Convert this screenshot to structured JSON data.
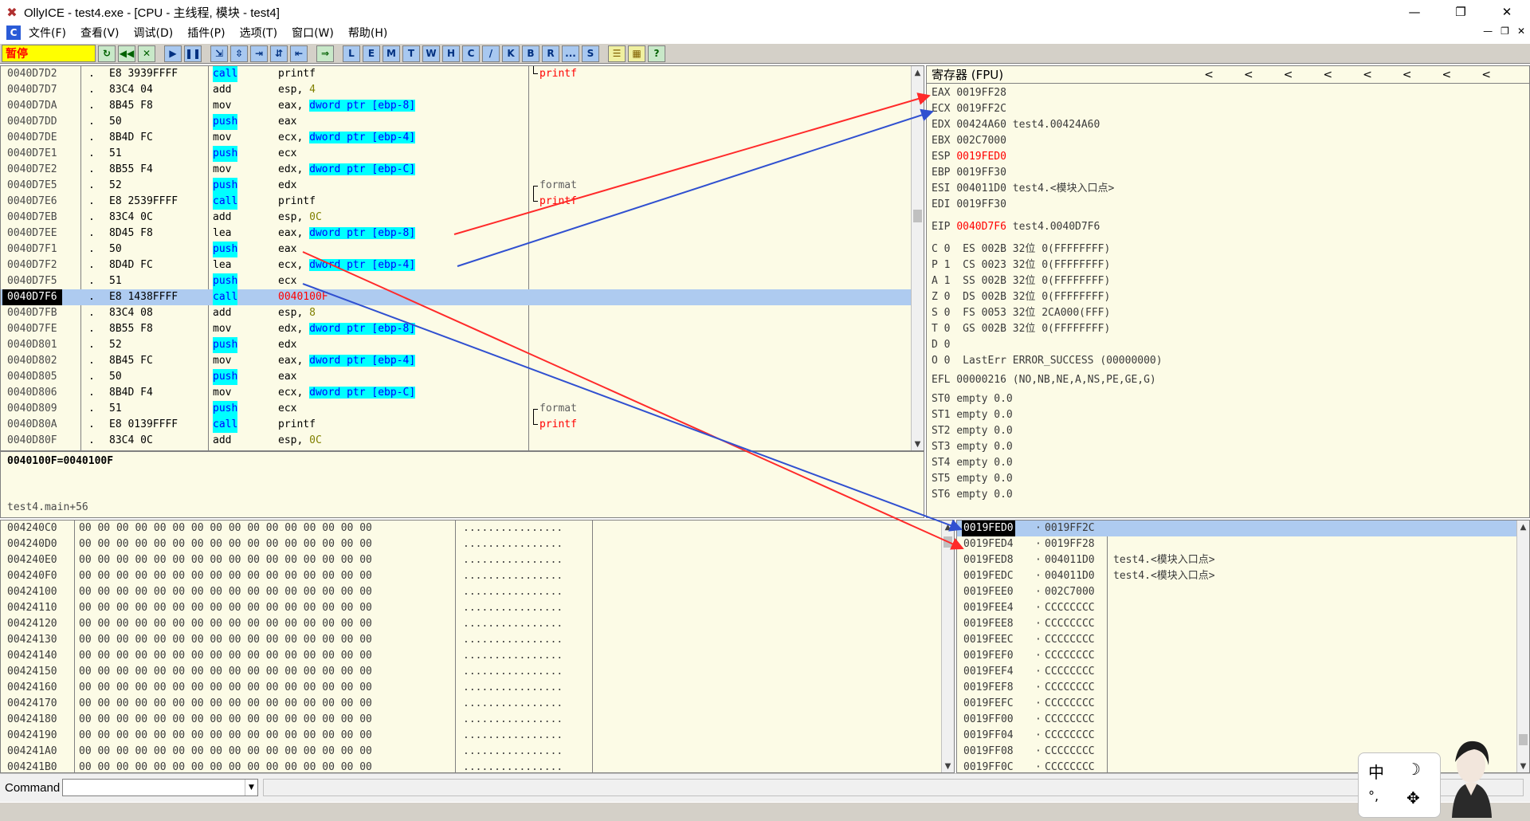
{
  "window": {
    "title": "OllyICE - test4.exe - [CPU - 主线程, 模块 - test4]",
    "min_label": "—",
    "max_label": "❐",
    "close_label": "✕"
  },
  "menu": {
    "items": [
      "文件(F)",
      "查看(V)",
      "调试(D)",
      "插件(P)",
      "选项(T)",
      "窗口(W)",
      "帮助(H)"
    ],
    "right": [
      "—",
      "❐",
      "✕"
    ]
  },
  "toolbar": {
    "status": "暂停",
    "buttons": [
      "↻",
      "◀◀",
      "✕",
      "▶",
      "❚❚",
      "⇲",
      "⇳",
      "⇥",
      "⇵",
      "⇤",
      "⇒"
    ],
    "letters": [
      "L",
      "E",
      "M",
      "T",
      "W",
      "H",
      "C",
      "/",
      "K",
      "B",
      "R",
      "...",
      "S"
    ],
    "tail": [
      "☰",
      "▦",
      "?"
    ]
  },
  "cpu": {
    "rows": [
      {
        "addr": "0040D7D2",
        "hex": "E8 3939FFFF",
        "mnem": "call",
        "ops": "printf",
        "cmt": "printf"
      },
      {
        "addr": "0040D7D7",
        "hex": "83C4 04",
        "mnem": "add",
        "ops": "esp, 4",
        "cmt": ""
      },
      {
        "addr": "0040D7DA",
        "hex": "8B45 F8",
        "mnem": "mov",
        "ops": "eax, dword ptr [ebp-8]",
        "cmt": ""
      },
      {
        "addr": "0040D7DD",
        "hex": "50",
        "mnem": "push",
        "ops": "eax",
        "cmt": ""
      },
      {
        "addr": "0040D7DE",
        "hex": "8B4D FC",
        "mnem": "mov",
        "ops": "ecx, dword ptr [ebp-4]",
        "cmt": ""
      },
      {
        "addr": "0040D7E1",
        "hex": "51",
        "mnem": "push",
        "ops": "ecx",
        "cmt": ""
      },
      {
        "addr": "0040D7E2",
        "hex": "8B55 F4",
        "mnem": "mov",
        "ops": "edx, dword ptr [ebp-C]",
        "cmt": ""
      },
      {
        "addr": "0040D7E5",
        "hex": "52",
        "mnem": "push",
        "ops": "edx",
        "cmt": "format"
      },
      {
        "addr": "0040D7E6",
        "hex": "E8 2539FFFF",
        "mnem": "call",
        "ops": "printf",
        "cmt": "printf"
      },
      {
        "addr": "0040D7EB",
        "hex": "83C4 0C",
        "mnem": "add",
        "ops": "esp, 0C",
        "cmt": ""
      },
      {
        "addr": "0040D7EE",
        "hex": "8D45 F8",
        "mnem": "lea",
        "ops": "eax, dword ptr [ebp-8]",
        "cmt": ""
      },
      {
        "addr": "0040D7F1",
        "hex": "50",
        "mnem": "push",
        "ops": "eax",
        "cmt": ""
      },
      {
        "addr": "0040D7F2",
        "hex": "8D4D FC",
        "mnem": "lea",
        "ops": "ecx, dword ptr [ebp-4]",
        "cmt": ""
      },
      {
        "addr": "0040D7F5",
        "hex": "51",
        "mnem": "push",
        "ops": "ecx",
        "cmt": ""
      },
      {
        "addr": "0040D7F6",
        "hex": "E8 1438FFFF",
        "mnem": "call",
        "ops": "0040100F",
        "cmt": ""
      },
      {
        "addr": "0040D7FB",
        "hex": "83C4 08",
        "mnem": "add",
        "ops": "esp, 8",
        "cmt": ""
      },
      {
        "addr": "0040D7FE",
        "hex": "8B55 F8",
        "mnem": "mov",
        "ops": "edx, dword ptr [ebp-8]",
        "cmt": ""
      },
      {
        "addr": "0040D801",
        "hex": "52",
        "mnem": "push",
        "ops": "edx",
        "cmt": ""
      },
      {
        "addr": "0040D802",
        "hex": "8B45 FC",
        "mnem": "mov",
        "ops": "eax, dword ptr [ebp-4]",
        "cmt": ""
      },
      {
        "addr": "0040D805",
        "hex": "50",
        "mnem": "push",
        "ops": "eax",
        "cmt": ""
      },
      {
        "addr": "0040D806",
        "hex": "8B4D F4",
        "mnem": "mov",
        "ops": "ecx, dword ptr [ebp-C]",
        "cmt": ""
      },
      {
        "addr": "0040D809",
        "hex": "51",
        "mnem": "push",
        "ops": "ecx",
        "cmt": "format"
      },
      {
        "addr": "0040D80A",
        "hex": "E8 0139FFFF",
        "mnem": "call",
        "ops": "printf",
        "cmt": "printf"
      },
      {
        "addr": "0040D80F",
        "hex": "83C4 0C",
        "mnem": "add",
        "ops": "esp, 0C",
        "cmt": ""
      }
    ],
    "selected_index": 14
  },
  "info": {
    "line1": "0040100F=0040100F",
    "line2": "test4.main+56"
  },
  "registers": {
    "header": "寄存器 (FPU)",
    "header_arrows": "<<<<<<<<",
    "lines": [
      {
        "name": "EAX",
        "val": "0019FF28",
        "extra": "",
        "red": false
      },
      {
        "name": "ECX",
        "val": "0019FF2C",
        "extra": "",
        "red": false
      },
      {
        "name": "EDX",
        "val": "00424A60",
        "extra": "test4.00424A60",
        "red": false
      },
      {
        "name": "EBX",
        "val": "002C7000",
        "extra": "",
        "red": false
      },
      {
        "name": "ESP",
        "val": "0019FED0",
        "extra": "",
        "red": true
      },
      {
        "name": "EBP",
        "val": "0019FF30",
        "extra": "",
        "red": false
      },
      {
        "name": "ESI",
        "val": "004011D0",
        "extra": "test4.<模块入口点>",
        "red": false
      },
      {
        "name": "EDI",
        "val": "0019FF30",
        "extra": "",
        "red": false
      }
    ],
    "eip": {
      "name": "EIP",
      "val": "0040D7F6",
      "extra": "test4.0040D7F6"
    },
    "segs": [
      "C 0  ES 002B 32位 0(FFFFFFFF)",
      "P 1  CS 0023 32位 0(FFFFFFFF)",
      "A 1  SS 002B 32位 0(FFFFFFFF)",
      "Z 0  DS 002B 32位 0(FFFFFFFF)",
      "S 0  FS 0053 32位 2CA000(FFF)",
      "T 0  GS 002B 32位 0(FFFFFFFF)",
      "D 0",
      "O 0  LastErr ERROR_SUCCESS (00000000)"
    ],
    "efl": "EFL 00000216 (NO,NB,NE,A,NS,PE,GE,G)",
    "fpu": [
      "ST0 empty 0.0",
      "ST1 empty 0.0",
      "ST2 empty 0.0",
      "ST3 empty 0.0",
      "ST4 empty 0.0",
      "ST5 empty 0.0",
      "ST6 empty 0.0"
    ]
  },
  "dump": {
    "addrs": [
      "004240C0",
      "004240D0",
      "004240E0",
      "004240F0",
      "00424100",
      "00424110",
      "00424120",
      "00424130",
      "00424140",
      "00424150",
      "00424160",
      "00424170",
      "00424180",
      "00424190",
      "004241A0",
      "004241B0"
    ],
    "hex": "00 00 00 00 00 00 00 00 00 00 00 00 00 00 00 00",
    "ascii": "................"
  },
  "stack": {
    "rows": [
      {
        "addr": "0019FED0",
        "val": "0019FF2C",
        "cmt": ""
      },
      {
        "addr": "0019FED4",
        "val": "0019FF28",
        "cmt": ""
      },
      {
        "addr": "0019FED8",
        "val": "004011D0",
        "cmt": "test4.<模块入口点>"
      },
      {
        "addr": "0019FEDC",
        "val": "004011D0",
        "cmt": "test4.<模块入口点>"
      },
      {
        "addr": "0019FEE0",
        "val": "002C7000",
        "cmt": ""
      },
      {
        "addr": "0019FEE4",
        "val": "CCCCCCCC",
        "cmt": ""
      },
      {
        "addr": "0019FEE8",
        "val": "CCCCCCCC",
        "cmt": ""
      },
      {
        "addr": "0019FEEC",
        "val": "CCCCCCCC",
        "cmt": ""
      },
      {
        "addr": "0019FEF0",
        "val": "CCCCCCCC",
        "cmt": ""
      },
      {
        "addr": "0019FEF4",
        "val": "CCCCCCCC",
        "cmt": ""
      },
      {
        "addr": "0019FEF8",
        "val": "CCCCCCCC",
        "cmt": ""
      },
      {
        "addr": "0019FEFC",
        "val": "CCCCCCCC",
        "cmt": ""
      },
      {
        "addr": "0019FF00",
        "val": "CCCCCCCC",
        "cmt": ""
      },
      {
        "addr": "0019FF04",
        "val": "CCCCCCCC",
        "cmt": ""
      },
      {
        "addr": "0019FF08",
        "val": "CCCCCCCC",
        "cmt": ""
      },
      {
        "addr": "0019FF0C",
        "val": "CCCCCCCC",
        "cmt": ""
      }
    ],
    "selected_index": 0
  },
  "command": {
    "label": "Command"
  },
  "ime": {
    "zh": "中",
    "moon": "☽",
    "dot": "°,",
    "bfly": "✥"
  },
  "colors": {
    "arrow_red": "#ff2a2a",
    "arrow_blue": "#3050d0",
    "pane_bg": "#fcfbe6",
    "selection": "#aecbf0"
  }
}
